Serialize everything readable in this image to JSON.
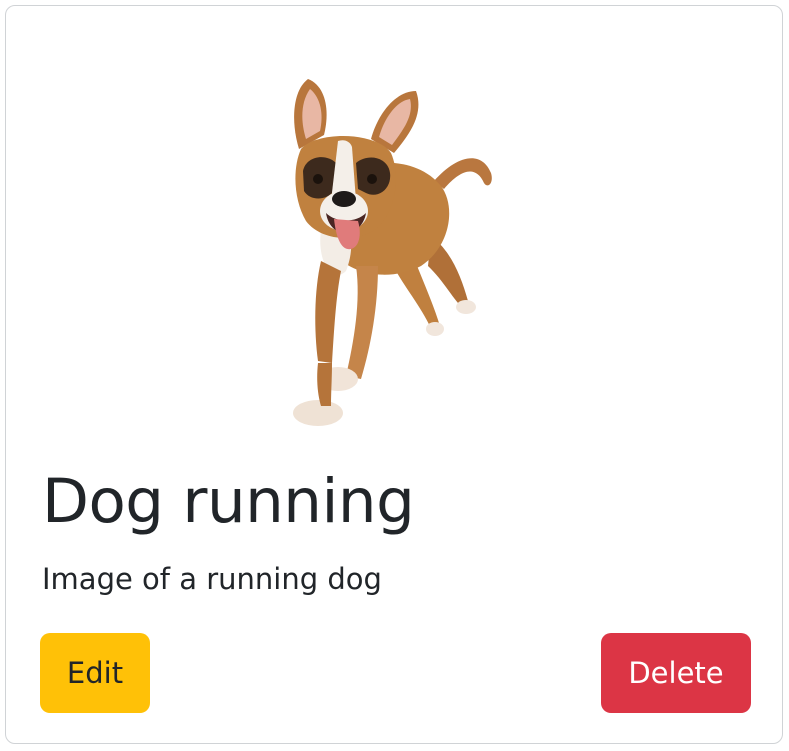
{
  "card": {
    "title": "Dog running",
    "text": "Image of a running dog",
    "image": {
      "alt": "Image of a running dog",
      "icon": "running-dog-photo"
    },
    "buttons": {
      "edit_label": "Edit",
      "delete_label": "Delete"
    }
  },
  "colors": {
    "edit": "#ffc107",
    "delete": "#dc3545",
    "text": "#212529",
    "border": "#d0d3d6"
  }
}
